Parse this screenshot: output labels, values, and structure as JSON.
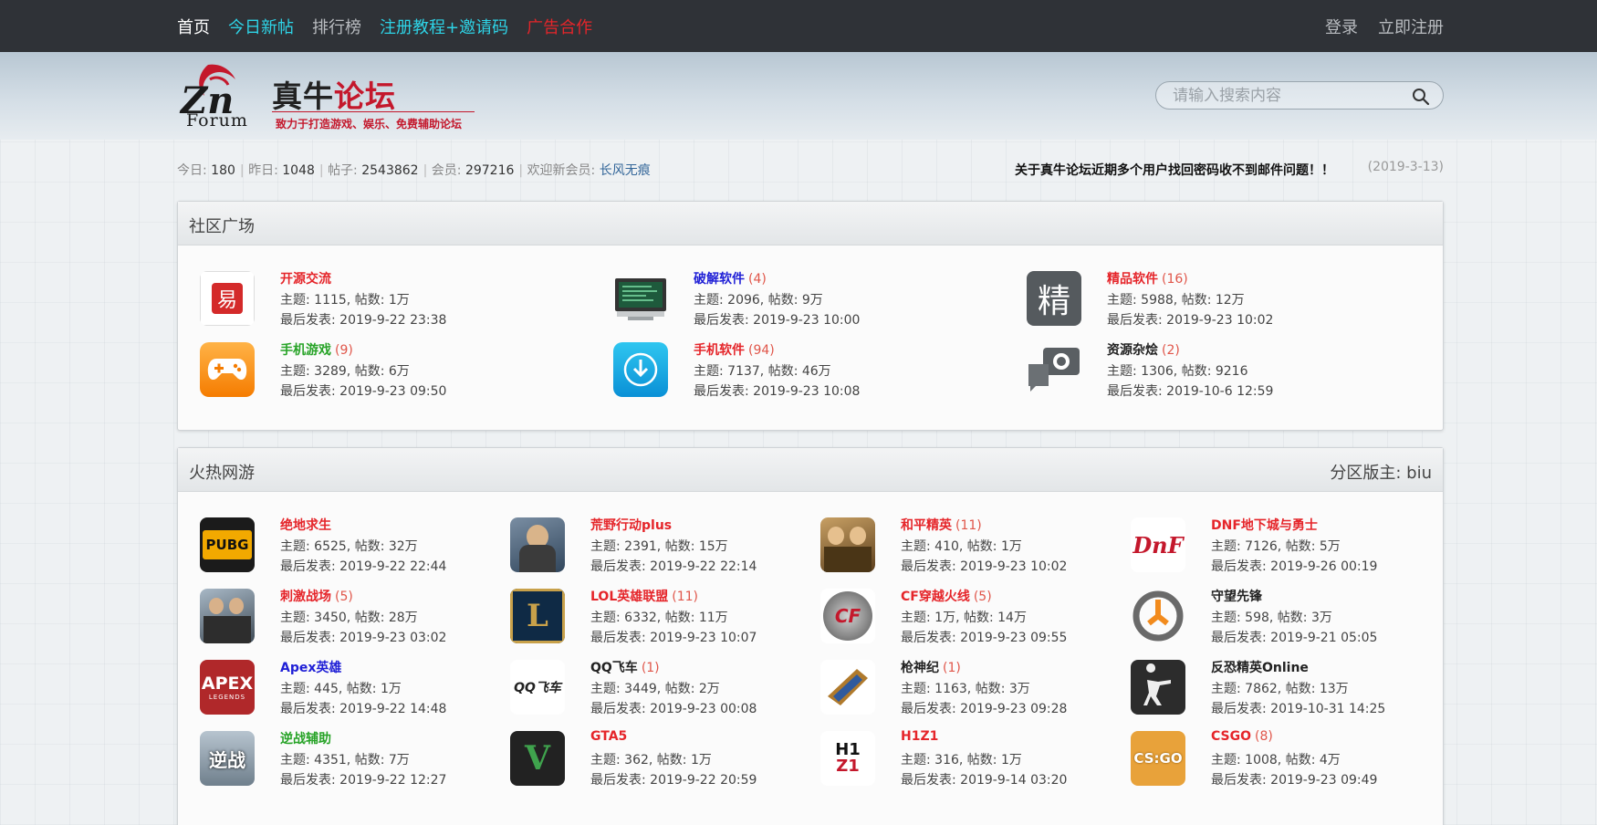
{
  "nav": {
    "left": [
      {
        "label": "首页",
        "color": "#ffffff"
      },
      {
        "label": "今日新帖",
        "color": "#2ed3e6"
      },
      {
        "label": "排行榜",
        "color": "#b9bcc0"
      },
      {
        "label": "注册教程+邀请码",
        "color": "#2ed3e6"
      },
      {
        "label": "广告合作",
        "color": "#e5252a"
      }
    ],
    "login": "登录",
    "register": "立即注册"
  },
  "logo": {
    "letters": "Zn",
    "forum": "Forum",
    "title_black": "真牛",
    "title_red": "论坛",
    "slogan": "致力于打造游戏、娱乐、免费辅助论坛"
  },
  "search": {
    "placeholder": "请输入搜索内容"
  },
  "stats": {
    "today_label": "今日:",
    "today": "180",
    "yesterday_label": "昨日:",
    "yesterday": "1048",
    "posts_label": "帖子:",
    "posts": "2543862",
    "members_label": "会员:",
    "members": "297216",
    "newmember_label": "欢迎新会员:",
    "newmember": "长风无痕",
    "notice": "关于真牛论坛近期多个用户找回密码收不到邮件问题！！",
    "notice_date": "(2019-3-13)"
  },
  "community": {
    "title": "社区广场",
    "forums": [
      {
        "name": "开源交流",
        "count": "",
        "color": "#e5252a",
        "stats": "主题: 1115, 帖数: 1万",
        "last": "最后发表: 2019-9-22 23:38",
        "icon": "yi-logo-icon"
      },
      {
        "name": "破解软件",
        "count": "(4)",
        "color": "#1f1fd6",
        "stats": "主题: 2096, 帖数: 9万",
        "last": "最后发表: 2019-9-23 10:00",
        "icon": "monitor-icon"
      },
      {
        "name": "精品软件",
        "count": "(16)",
        "color": "#e5252a",
        "stats": "主题: 5988, 帖数: 12万",
        "last": "最后发表: 2019-9-23 10:02",
        "icon": "jing-icon"
      },
      {
        "name": "手机游戏",
        "count": "(9)",
        "color": "#27a327",
        "stats": "主题: 3289, 帖数: 6万",
        "last": "最后发表: 2019-9-23 09:50",
        "icon": "gamepad-icon"
      },
      {
        "name": "手机软件",
        "count": "(94)",
        "color": "#e5252a",
        "stats": "主题: 7137, 帖数: 46万",
        "last": "最后发表: 2019-9-23 10:08",
        "icon": "download-icon"
      },
      {
        "name": "资源杂烩",
        "count": "(2)",
        "color": "#222222",
        "stats": "主题: 1306, 帖数: 9216",
        "last": "最后发表: 2019-10-6 12:59",
        "icon": "camera-chat-icon"
      }
    ]
  },
  "games": {
    "title": "火热网游",
    "moderator": "分区版主: biu",
    "forums": [
      {
        "name": "绝地求生",
        "count": "",
        "color": "#e5252a",
        "stats": "主题: 6525, 帖数: 32万",
        "last": "最后发表: 2019-9-22 22:44",
        "icon": "pubg-icon",
        "icon_text": "PUBG"
      },
      {
        "name": "荒野行动plus",
        "count": "",
        "color": "#e5252a",
        "stats": "主题: 2391, 帖数: 15万",
        "last": "最后发表: 2019-9-22 22:14",
        "icon": "knives-out-icon",
        "icon_text": ""
      },
      {
        "name": "和平精英",
        "count": "(11)",
        "color": "#e5252a",
        "stats": "主题: 410, 帖数: 1万",
        "last": "最后发表: 2019-9-23 10:02",
        "icon": "peace-elite-icon",
        "icon_text": ""
      },
      {
        "name": "DNF地下城与勇士",
        "count": "",
        "color": "#e5252a",
        "stats": "主题: 7126, 帖数: 5万",
        "last": "最后发表: 2019-9-26 00:19",
        "icon": "dnf-icon",
        "icon_text": "DnF"
      },
      {
        "name": "刺激战场",
        "count": "(5)",
        "color": "#e5252a",
        "stats": "主题: 3450, 帖数: 28万",
        "last": "最后发表: 2019-9-23 03:02",
        "icon": "pubg-mobile-icon",
        "icon_text": ""
      },
      {
        "name": "LOL英雄联盟",
        "count": "(11)",
        "color": "#e5252a",
        "stats": "主题: 6332, 帖数: 11万",
        "last": "最后发表: 2019-9-23 10:07",
        "icon": "lol-icon",
        "icon_text": "L"
      },
      {
        "name": "CF穿越火线",
        "count": "(5)",
        "color": "#e5252a",
        "stats": "主题: 1万, 帖数: 14万",
        "last": "最后发表: 2019-9-23 09:55",
        "icon": "cf-icon",
        "icon_text": "CF"
      },
      {
        "name": "守望先锋",
        "count": "",
        "color": "#222222",
        "stats": "主题: 598, 帖数: 3万",
        "last": "最后发表: 2019-9-21 05:05",
        "icon": "overwatch-icon",
        "icon_text": ""
      },
      {
        "name": "Apex英雄",
        "count": "",
        "color": "#1f1fd6",
        "stats": "主题: 445, 帖数: 1万",
        "last": "最后发表: 2019-9-22 14:48",
        "icon": "apex-icon",
        "icon_text": "APEX"
      },
      {
        "name": "QQ飞车",
        "count": "(1)",
        "color": "#222222",
        "stats": "主题: 3449, 帖数: 2万",
        "last": "最后发表: 2019-9-23 00:08",
        "icon": "qq-speed-icon",
        "icon_text": "QQ飞车"
      },
      {
        "name": "枪神纪",
        "count": "(1)",
        "color": "#222222",
        "stats": "主题: 1163, 帖数: 3万",
        "last": "最后发表: 2019-9-23 09:28",
        "icon": "gun-icon",
        "icon_text": ""
      },
      {
        "name": "反恐精英Online",
        "count": "",
        "color": "#222222",
        "stats": "主题: 7862, 帖数: 13万",
        "last": "最后发表: 2019-10-31 14:25",
        "icon": "csol-icon",
        "icon_text": ""
      },
      {
        "name": "逆战辅助",
        "count": "",
        "color": "#27a327",
        "stats": "主题: 4351, 帖数: 7万",
        "last": "最后发表: 2019-9-22 12:27",
        "icon": "nizhan-icon",
        "icon_text": "逆战"
      },
      {
        "name": "GTA5",
        "count": "",
        "color": "#e5252a",
        "stats": "主题: 362, 帖数: 1万",
        "last": "最后发表: 2019-9-22 20:59",
        "icon": "gta5-icon",
        "icon_text": "V"
      },
      {
        "name": "H1Z1",
        "count": "",
        "color": "#e5252a",
        "stats": "主题: 316, 帖数: 1万",
        "last": "最后发表: 2019-9-14 03:20",
        "icon": "h1z1-icon",
        "icon_text": "H1Z1"
      },
      {
        "name": "CSGO",
        "count": "(8)",
        "color": "#e5252a",
        "stats": "主题: 1008, 帖数: 4万",
        "last": "最后发表: 2019-9-23 09:49",
        "icon": "csgo-icon",
        "icon_text": "CS:GO"
      }
    ]
  }
}
